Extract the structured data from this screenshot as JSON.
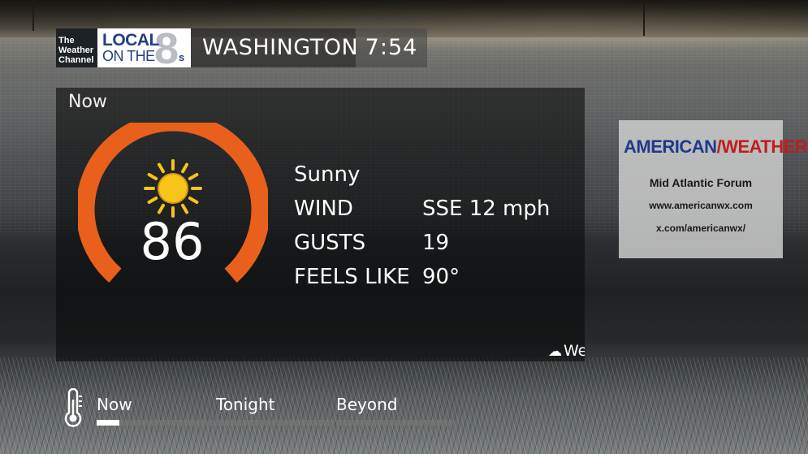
{
  "header": {
    "network_logo": [
      "The",
      "Weather",
      "Channel"
    ],
    "brand_logo": {
      "top": "LOCAL",
      "bottom": "ON THE",
      "number": "8",
      "suffix": "s"
    },
    "city": "WASHINGTON",
    "time": "7:54"
  },
  "current": {
    "title": "Now",
    "temperature": "86",
    "condition": "Sunny",
    "condition_icon": "sun-icon",
    "gauge_color": "#E8601C",
    "rows": [
      {
        "label": "WIND",
        "value": "SSE 12 mph"
      },
      {
        "label": "GUSTS",
        "value": "19"
      },
      {
        "label": "FEELS LIKE",
        "value": "90°"
      }
    ],
    "next_panel_peek": {
      "icon": "cloud-icon",
      "text": "We"
    }
  },
  "ad": {
    "logo_part1": "AMERICAN",
    "logo_part2": "WEATHER",
    "forum": "Mid Atlantic Forum",
    "url1": "www.americanwx.com",
    "url2": "x.com/americanwx/"
  },
  "nav": {
    "icon": "thermometer-icon",
    "items": [
      {
        "label": "Now",
        "progress": 0.19
      },
      {
        "label": "Tonight",
        "progress": 0
      },
      {
        "label": "Beyond",
        "progress": 0
      }
    ]
  }
}
